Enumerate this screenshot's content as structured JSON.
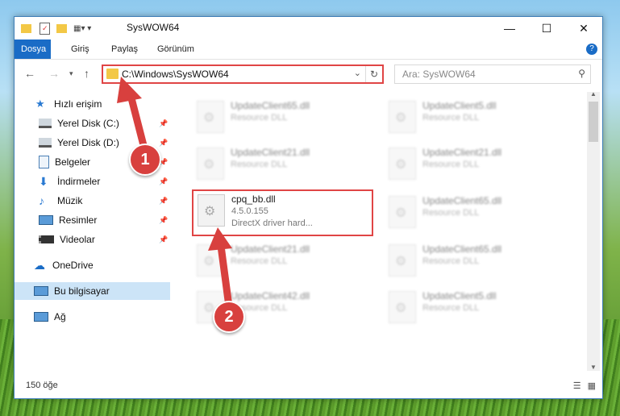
{
  "window": {
    "title": "SysWOW64"
  },
  "ribbon": {
    "tabs": [
      {
        "label": "Dosya"
      },
      {
        "label": "Giriş"
      },
      {
        "label": "Paylaş"
      },
      {
        "label": "Görünüm"
      }
    ],
    "help": "?"
  },
  "address": {
    "path": "C:\\Windows\\SysWOW64"
  },
  "search": {
    "placeholder": "Ara: SysWOW64"
  },
  "sidebar": {
    "quick_access": "Hızlı erişim",
    "items": [
      {
        "label": "Yerel Disk (C:)"
      },
      {
        "label": "Yerel Disk (D:)"
      },
      {
        "label": "Belgeler"
      },
      {
        "label": "İndirmeler"
      },
      {
        "label": "Müzik"
      },
      {
        "label": "Resimler"
      },
      {
        "label": "Videolar"
      }
    ],
    "onedrive": "OneDrive",
    "this_pc": "Bu bilgisayar",
    "network": "Ağ"
  },
  "files": {
    "left": [
      {
        "name": "UpdateClient65.dll",
        "desc": "Resource DLL"
      },
      {
        "name": "UpdateClient21.dll",
        "desc": "Resource DLL"
      },
      {
        "name": "cpq_bb.dll",
        "version": "4.5.0.155",
        "desc": "DirectX driver hard..."
      },
      {
        "name": "UpdateClient21.dll",
        "desc": "Resource DLL"
      },
      {
        "name": "UpdateClient42.dll",
        "desc": "Resource DLL"
      }
    ],
    "right": [
      {
        "name": "UpdateClient5.dll",
        "desc": "Resource DLL"
      },
      {
        "name": "UpdateClient21.dll",
        "desc": "Resource DLL"
      },
      {
        "name": "UpdateClient65.dll",
        "desc": "Resource DLL"
      },
      {
        "name": "UpdateClient65.dll",
        "desc": "Resource DLL"
      },
      {
        "name": "UpdateClient5.dll",
        "desc": "Resource DLL"
      }
    ]
  },
  "status": {
    "count": "150 öğe"
  },
  "annotations": {
    "step1": "1",
    "step2": "2"
  },
  "colors": {
    "accent": "#1a6cc6",
    "highlight": "#e04545"
  }
}
